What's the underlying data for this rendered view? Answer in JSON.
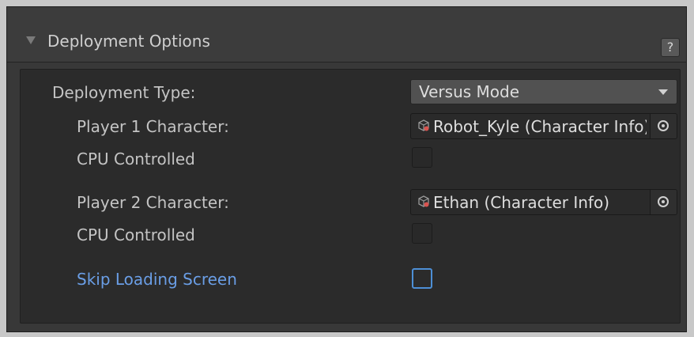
{
  "section": {
    "title": "Deployment Options",
    "help_label": "?"
  },
  "fields": {
    "deployment_type_label": "Deployment Type:",
    "deployment_type_value": "Versus Mode",
    "player1_label": "Player 1 Character:",
    "player1_value": "Robot_Kyle (Character Info)",
    "player1_cpu_label": "CPU Controlled",
    "player1_cpu_checked": false,
    "player2_label": "Player 2 Character:",
    "player2_value": "Ethan (Character Info)",
    "player2_cpu_label": "CPU Controlled",
    "player2_cpu_checked": false,
    "skip_loading_label": "Skip Loading Screen",
    "skip_loading_checked": false
  },
  "icons": {
    "foldout": "triangle-down-icon",
    "object": "scriptable-object-icon",
    "picker": "object-picker-icon",
    "dropdown_caret": "chevron-down-icon"
  },
  "colors": {
    "link_label": "#6a9ee6",
    "focus_border": "#4d8fd6"
  }
}
